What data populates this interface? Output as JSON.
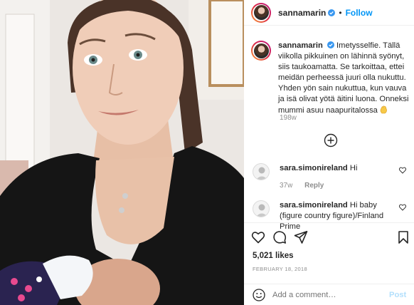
{
  "post": {
    "photo_description_icon": "photo-selfie",
    "username": "sannamarin",
    "follow_label": "Follow",
    "dot": "•",
    "caption": {
      "username": "sannamarin",
      "text": "Imetysselfie. Tällä viikolla pikkuinen on lähinnä syönyt, siis taukoamatta. Se tarkoittaa, ettei meidän perheessä juuri olla nukuttu. Yhden yön sain nukuttua, kun vauva ja isä olivat yötä äitini luona. Onneksi mummi asuu naapuritalossa",
      "emoji_icon": "clapping-hand-icon",
      "age": "198w"
    },
    "comments": [
      {
        "username": "sara.simonireland",
        "text": "Hi",
        "age": "37w",
        "reply_label": "Reply"
      },
      {
        "username": "sara.simonireland",
        "text": "Hi baby (figure country figure)/Finland Prime",
        "age": "",
        "reply_label": ""
      }
    ],
    "likes": "5,021 likes",
    "date": "FEBRUARY 18, 2018",
    "add_comment_placeholder": "Add a comment…",
    "post_label": "Post"
  },
  "colors": {
    "link_blue": "#0095f6",
    "post_disabled": "#b2dffc",
    "muted": "#8e8e8e",
    "text": "#262626"
  }
}
